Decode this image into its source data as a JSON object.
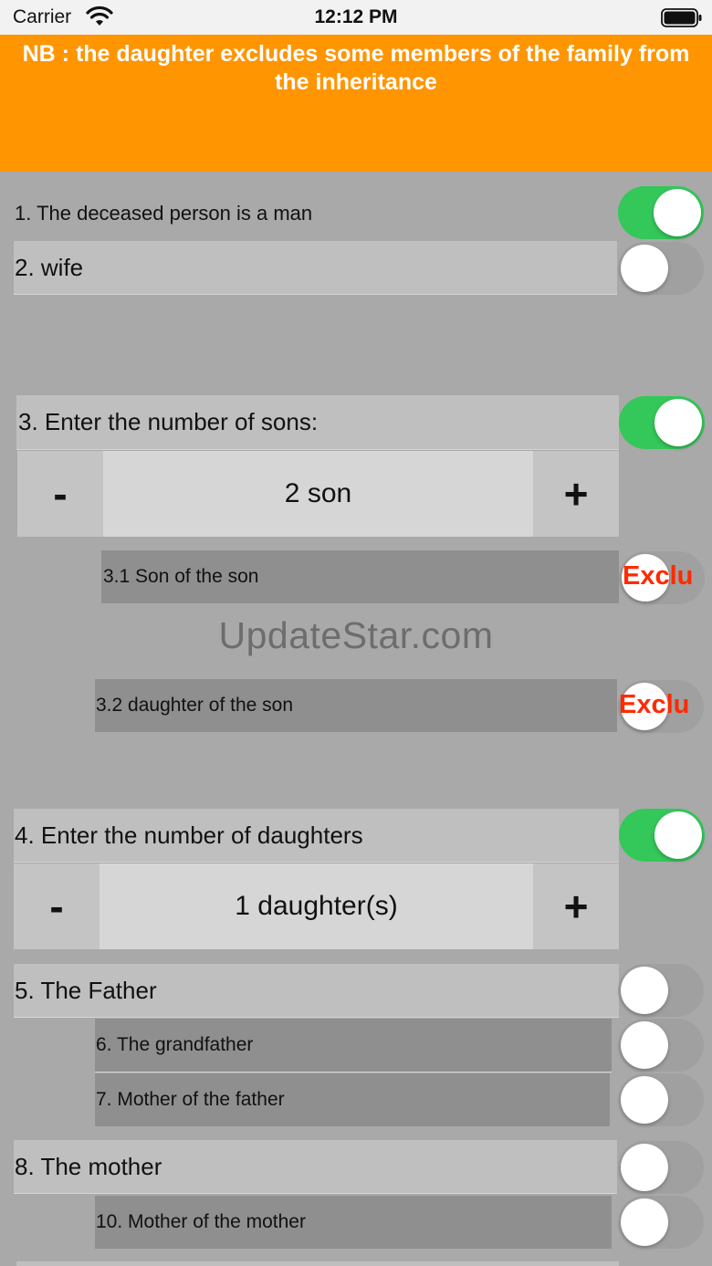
{
  "status_bar": {
    "carrier": "Carrier",
    "time": "12:12 PM"
  },
  "banner": {
    "text": "NB : the daughter excludes some members of the family from the inheritance"
  },
  "rows": {
    "r1": {
      "label": "1. The deceased person is a man",
      "switch": "on"
    },
    "r2": {
      "label": "2. wife",
      "switch": "off"
    },
    "r3": {
      "label": "3. Enter the number of sons:",
      "switch": "on"
    },
    "r3_stepper": {
      "minus": "-",
      "value": "2 son",
      "plus": "+"
    },
    "r31": {
      "label": "3.1 Son of the son",
      "status": "Exclu"
    },
    "r32": {
      "label": "3.2 daughter of the son",
      "status": "Exclu"
    },
    "r4": {
      "label": "4. Enter the number of daughters",
      "switch": "on"
    },
    "r4_stepper": {
      "minus": "-",
      "value": "1 daughter(s)",
      "plus": "+"
    },
    "r5": {
      "label": "5. The Father",
      "switch": "off"
    },
    "r6": {
      "label": "6. The grandfather",
      "switch": "off"
    },
    "r7": {
      "label": "7. Mother of the father",
      "switch": "off"
    },
    "r8": {
      "label": "8. The mother",
      "switch": "off"
    },
    "r10": {
      "label": "10. Mother of the mother",
      "switch": "off"
    }
  },
  "watermark": "UpdateStar.com",
  "colors": {
    "banner": "#ff9500",
    "switch_on": "#34c759",
    "exclu": "#ff2a00",
    "background": "#a9a9a9"
  }
}
